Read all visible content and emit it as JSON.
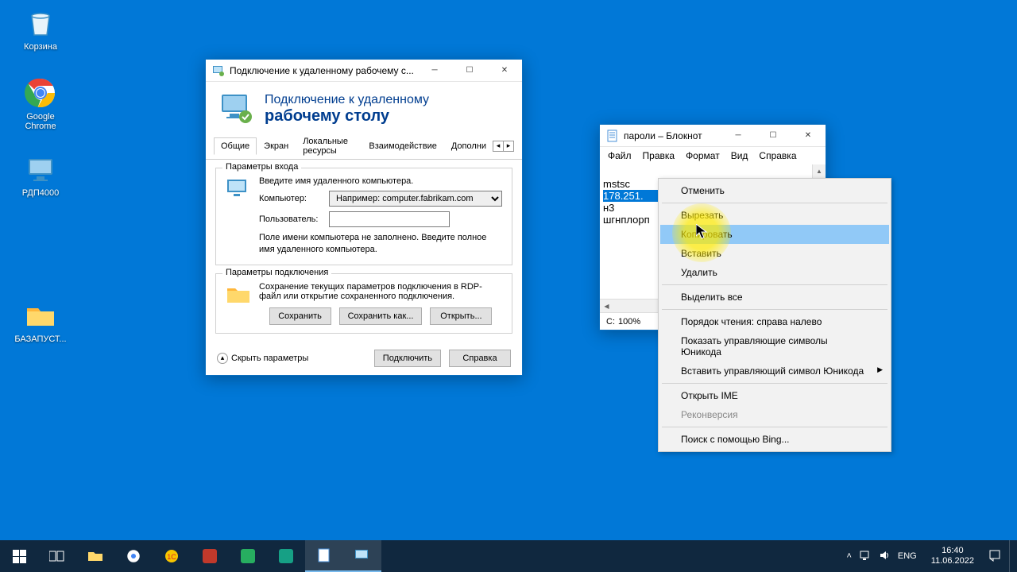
{
  "desktop": {
    "icons": [
      {
        "label": "Корзина"
      },
      {
        "label": "Google Chrome"
      },
      {
        "label": "РДП4000"
      },
      {
        "label": "БАЗАПУСТ..."
      }
    ]
  },
  "rdp": {
    "title": "Подключение к удаленному рабочему с...",
    "header_line1": "Подключение к удаленному",
    "header_line2": "рабочему столу",
    "tabs": [
      "Общие",
      "Экран",
      "Локальные ресурсы",
      "Взаимодействие",
      "Дополни"
    ],
    "group_login": {
      "legend": "Параметры входа",
      "prompt": "Введите имя удаленного компьютера.",
      "computer_label": "Компьютер:",
      "computer_placeholder": "Например: computer.fabrikam.com",
      "user_label": "Пользователь:",
      "user_value": "",
      "hint": "Поле имени компьютера не заполнено. Введите полное имя удаленного компьютера."
    },
    "group_conn": {
      "legend": "Параметры подключения",
      "text": "Сохранение текущих параметров подключения в RDP-файл или открытие сохраненного подключения.",
      "save": "Сохранить",
      "save_as": "Сохранить как...",
      "open": "Открыть..."
    },
    "footer": {
      "collapse": "Скрыть параметры",
      "connect": "Подключить",
      "help": "Справка"
    }
  },
  "notepad": {
    "title": "пароли – Блокнот",
    "menu": [
      "Файл",
      "Правка",
      "Формат",
      "Вид",
      "Справка"
    ],
    "lines": {
      "l1": "mstsc",
      "l2_selected": "178.251.",
      "l3": "н3",
      "l4": "шгнплорп"
    },
    "status": {
      "col": "С:",
      "zoom": "100%"
    }
  },
  "context_menu": {
    "undo": "Отменить",
    "cut": "Вырезать",
    "copy": "Копировать",
    "paste": "Вставить",
    "delete": "Удалить",
    "select_all": "Выделить все",
    "rtl": "Порядок чтения: справа налево",
    "show_unicode": "Показать управляющие символы Юникода",
    "insert_unicode": "Вставить управляющий символ Юникода",
    "open_ime": "Открыть IME",
    "reconversion": "Реконверсия",
    "bing": "Поиск с помощью Bing..."
  },
  "taskbar": {
    "lang": "ENG",
    "time": "16:40",
    "date": "11.06.2022"
  }
}
